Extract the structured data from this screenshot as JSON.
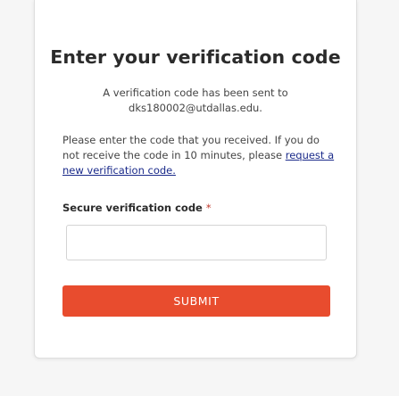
{
  "page": {
    "title": "Enter your verification code",
    "sent_prefix": "A verification code has been sent to",
    "email": "dks180002@utdallas.edu."
  },
  "instructions": {
    "text": "Please enter the code that you received. If you do not receive the code in 10 minutes, please ",
    "link_text": "request a new verification code."
  },
  "form": {
    "code_label": "Secure verification code",
    "required_marker": "*",
    "code_value": "",
    "submit_label": "SUBMIT"
  },
  "colors": {
    "accent": "#e84c2e",
    "link": "#1a2a8a",
    "title": "#2b2b2b"
  }
}
